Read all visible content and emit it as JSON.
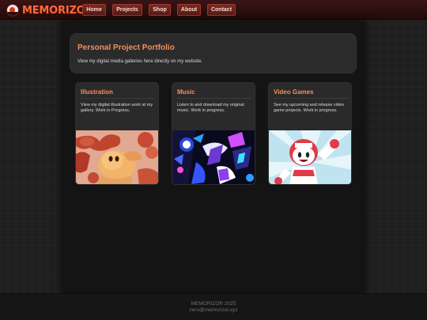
{
  "header": {
    "logo_text": "MEMORIZOR",
    "nav": [
      {
        "label": "Home"
      },
      {
        "label": "Projects"
      },
      {
        "label": "Shop"
      },
      {
        "label": "About"
      },
      {
        "label": "Contact"
      }
    ]
  },
  "hero": {
    "title": "Personal Project Portfolio",
    "subtitle": "View my digital media galleries here directly on my website."
  },
  "cards": [
    {
      "title": "Illustration",
      "text": "View my digital illustration work at my gallery. Work in Progress.",
      "image_icon": "illustration-artwork-icon"
    },
    {
      "title": "Music",
      "text": "Listen to and download my original music. Work in progress.",
      "image_icon": "music-artwork-icon"
    },
    {
      "title": "Video Games",
      "text": "See my upcoming and release video game projects. Work in progress.",
      "image_icon": "game-character-icon"
    }
  ],
  "footer": {
    "line1": "MEMORIZOR 2025",
    "line2": "zero@memorizor.xyz"
  },
  "colors": {
    "accent": "#f28f60",
    "logo": "#ff6a3d",
    "nav_button": "#6a231c",
    "header_bg": "#2e0f0f"
  }
}
